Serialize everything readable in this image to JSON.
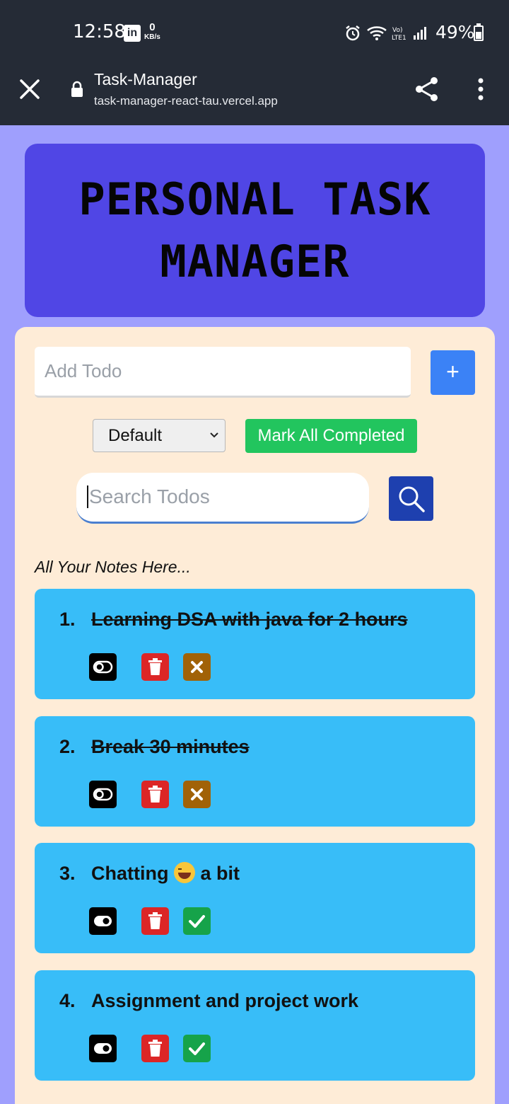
{
  "status_bar": {
    "time": "12:58",
    "linkedin_icon": "linkedin-icon",
    "net_speed_value": "0",
    "net_speed_unit": "KB/s",
    "battery": "49%"
  },
  "browser": {
    "title": "Task-Manager",
    "url": "task-manager-react-tau.vercel.app"
  },
  "header": {
    "title": "PERSONAL TASK MANAGER"
  },
  "add": {
    "placeholder": "Add Todo",
    "button_label": "+"
  },
  "filter": {
    "selected": "Default"
  },
  "mark_all_label": "Mark All Completed",
  "search": {
    "placeholder": "Search Todos"
  },
  "notes_heading": "All Your Notes Here...",
  "todos": [
    {
      "number": "1.",
      "text": "Learning DSA with java for 2 hours",
      "completed": true
    },
    {
      "number": "2.",
      "text": "Break 30 minutes",
      "completed": true
    },
    {
      "number": "3.",
      "text_before": "Chatting",
      "text_after": "a bit",
      "emoji": "grinning-face",
      "completed": false
    },
    {
      "number": "4.",
      "text": "Assignment and project work",
      "completed": false
    }
  ],
  "colors": {
    "page_bg": "#9f9ffd",
    "header_bg": "#5046e5",
    "panel_bg": "#feecd7",
    "todo_bg": "#38bdf8",
    "add_button": "#3b82f6",
    "mark_all": "#22c55e",
    "search_button": "#1e40af",
    "delete": "#dc2626",
    "undo": "#a16207",
    "check": "#16a34a"
  }
}
